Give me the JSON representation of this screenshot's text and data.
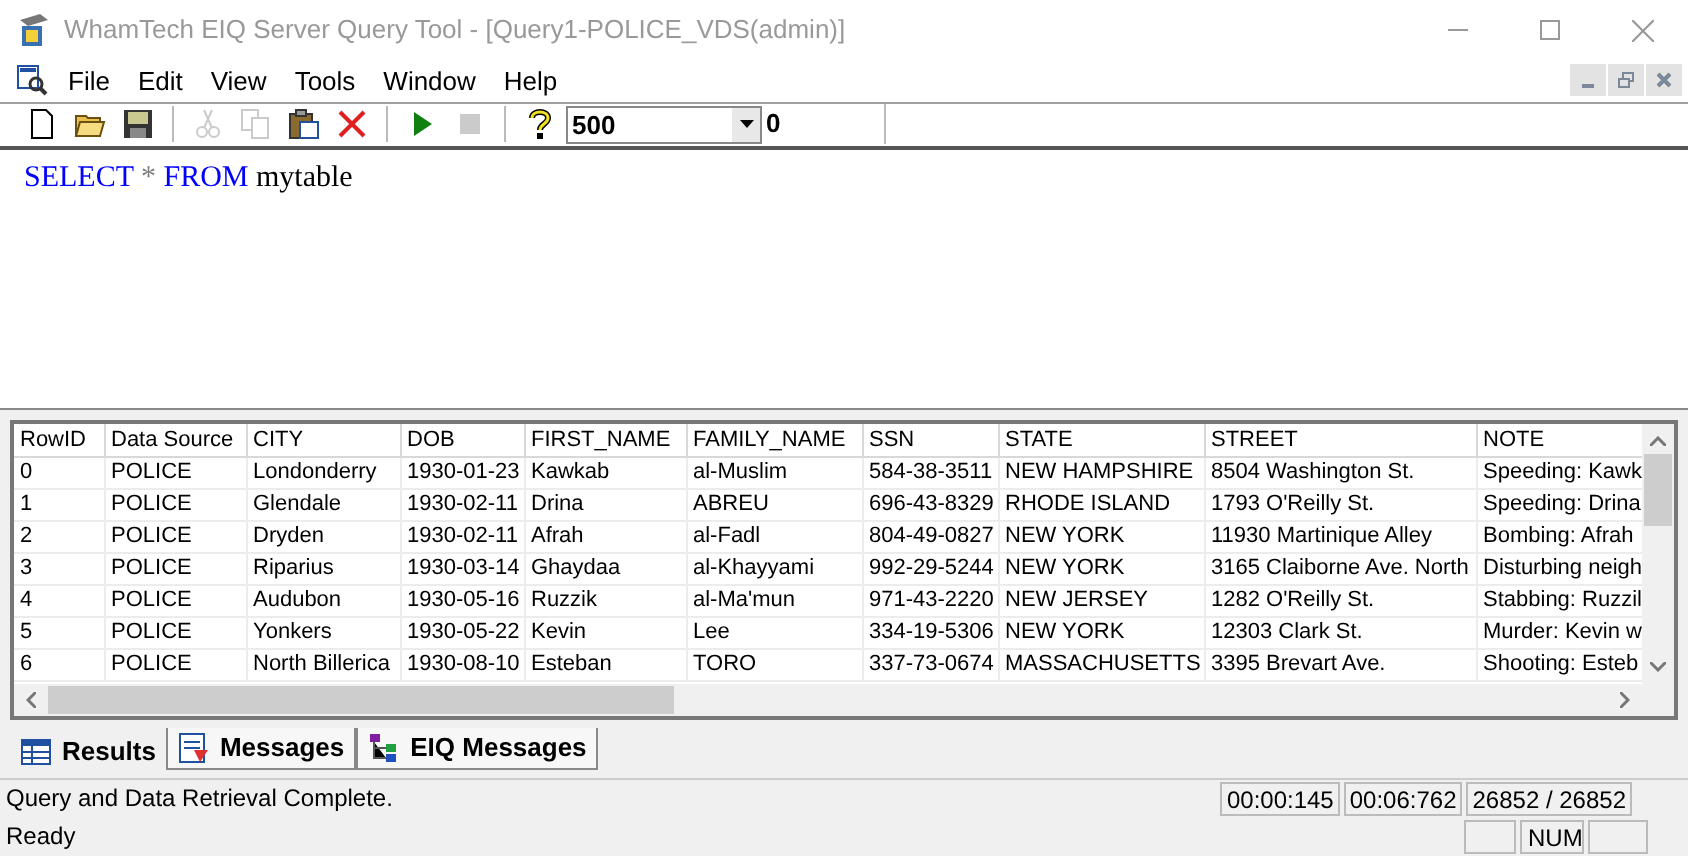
{
  "window": {
    "title": "WhamTech EIQ Server Query Tool - [Query1-POLICE_VDS(admin)]"
  },
  "menu": [
    "File",
    "Edit",
    "View",
    "Tools",
    "Window",
    "Help"
  ],
  "toolbar": {
    "buttons": [
      {
        "kind": "new",
        "disabled": false
      },
      {
        "kind": "open",
        "disabled": false
      },
      {
        "kind": "save",
        "disabled": false
      },
      {
        "kind": "separator"
      },
      {
        "kind": "cut",
        "disabled": true
      },
      {
        "kind": "copy",
        "disabled": true
      },
      {
        "kind": "paste",
        "disabled": false
      },
      {
        "kind": "delete",
        "disabled": false
      },
      {
        "kind": "separator"
      },
      {
        "kind": "run",
        "disabled": false
      },
      {
        "kind": "stop",
        "disabled": true
      },
      {
        "kind": "separator"
      },
      {
        "kind": "help",
        "disabled": false
      }
    ],
    "row_limit": "500",
    "count": "0"
  },
  "editor": {
    "tokens": [
      {
        "text": "SELECT",
        "kind": "keyword"
      },
      {
        "text": "*",
        "kind": "operator"
      },
      {
        "text": "FROM",
        "kind": "keyword"
      },
      {
        "text": "mytable",
        "kind": "identifier"
      }
    ]
  },
  "table": {
    "columns": [
      "RowID",
      "Data Source",
      "CITY",
      "DOB",
      "FIRST_NAME",
      "FAMILY_NAME",
      "SSN",
      "STATE",
      "STREET",
      "NOTE"
    ],
    "rows": [
      [
        "0",
        "POLICE",
        "Londonderry",
        "1930-01-23",
        "Kawkab",
        "al-Muslim",
        "584-38-3511",
        "NEW HAMPSHIRE",
        "8504 Washington St.",
        "Speeding: Kawk"
      ],
      [
        "1",
        "POLICE",
        "Glendale",
        "1930-02-11",
        "Drina",
        "ABREU",
        "696-43-8329",
        "RHODE ISLAND",
        "1793 O'Reilly St.",
        "Speeding: Drina"
      ],
      [
        "2",
        "POLICE",
        "Dryden",
        "1930-02-11",
        "Afrah",
        "al-Fadl",
        "804-49-0827",
        "NEW YORK",
        "11930 Martinique Alley",
        "Bombing: Afrah"
      ],
      [
        "3",
        "POLICE",
        "Riparius",
        "1930-03-14",
        "Ghaydaa",
        "al-Khayyami",
        "992-29-5244",
        "NEW YORK",
        "3165 Claiborne Ave. North",
        "Disturbing neigh"
      ],
      [
        "4",
        "POLICE",
        "Audubon",
        "1930-05-16",
        "Ruzzik",
        "al-Ma'mun",
        "971-43-2220",
        "NEW JERSEY",
        "1282 O'Reilly St.",
        "Stabbing: Ruzzil"
      ],
      [
        "5",
        "POLICE",
        "Yonkers",
        "1930-05-22",
        "Kevin",
        "Lee",
        "334-19-5306",
        "NEW YORK",
        "12303 Clark St.",
        "Murder: Kevin w"
      ],
      [
        "6",
        "POLICE",
        "North Billerica",
        "1930-08-10",
        "Esteban",
        "TORO",
        "337-73-0674",
        "MASSACHUSETTS",
        "3395 Brevart Ave.",
        "Shooting: Esteb"
      ]
    ]
  },
  "tabs": [
    {
      "label": "Results",
      "selected": true,
      "kind": "grid"
    },
    {
      "label": "Messages",
      "selected": false,
      "kind": "messages"
    },
    {
      "label": "EIQ Messages",
      "selected": false,
      "kind": "eiq"
    }
  ],
  "status": {
    "message": "Query and Data Retrieval Complete.",
    "panels": [
      "00:00:145",
      "00:06:762",
      "26852 / 26852"
    ]
  },
  "status_bar": {
    "text": "Ready",
    "indicators": [
      "NUM"
    ]
  }
}
